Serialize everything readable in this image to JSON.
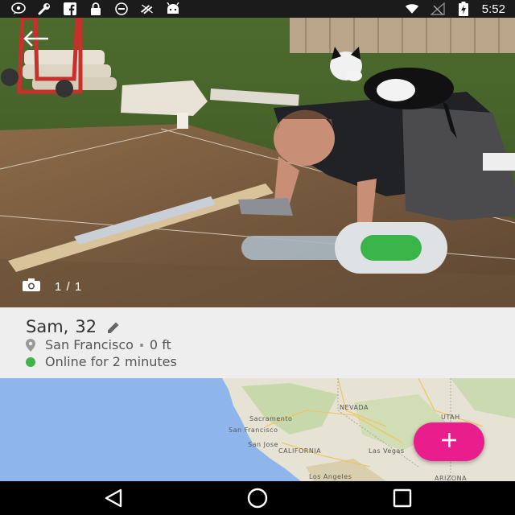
{
  "status_bar": {
    "time": "5:52",
    "icons": [
      "chat-icon",
      "wrench-icon",
      "facebook-icon",
      "lock-icon",
      "info-circle-icon",
      "no-data-icon",
      "android-icon",
      "wifi-icon",
      "no-signal-icon",
      "battery-charging-icon"
    ]
  },
  "photo": {
    "counter": "1 / 1",
    "back_icon": "back-arrow-icon",
    "camera_icon": "camera-icon"
  },
  "toggle": {
    "state": "on",
    "color": "#3bb54a"
  },
  "profile": {
    "name": "Sam",
    "separator": ",",
    "age": "32",
    "location": "San Francisco",
    "distance": "0 ft",
    "status": "Online for 2 minutes"
  },
  "map": {
    "labels": {
      "nevada": "NEVADA",
      "utah": "UTAH",
      "sacramento": "Sacramento",
      "san_francisco": "San Francisco",
      "san_jose": "San Jose",
      "california": "CALIFORNIA",
      "las_vegas": "Las Vegas",
      "los_angeles": "Los Angeles",
      "arizona": "ARIZONA"
    }
  },
  "fab": {
    "icon": "plus-icon",
    "color": "#e91e8c"
  },
  "nav": {
    "icons": [
      "back-triangle-icon",
      "home-circle-icon",
      "recents-square-icon"
    ]
  }
}
